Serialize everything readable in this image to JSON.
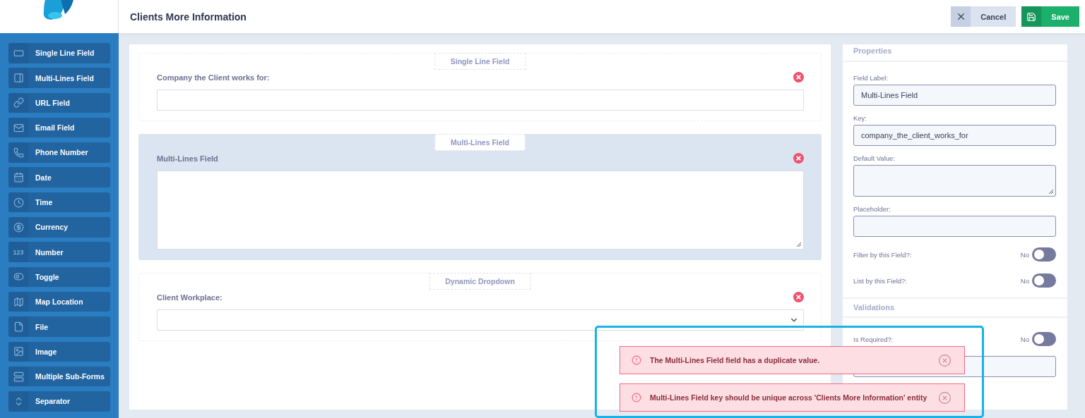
{
  "header": {
    "title": "Clients More Information",
    "buttons": [
      {
        "kind": "cancel",
        "label": "Cancel"
      },
      {
        "kind": "save",
        "label": "Save"
      }
    ]
  },
  "sidebar": {
    "items": [
      {
        "kind": "single",
        "label": "Single Line Field"
      },
      {
        "kind": "multi",
        "label": "Multi-Lines Field"
      },
      {
        "kind": "url",
        "label": "URL Field"
      },
      {
        "kind": "email",
        "label": "Email Field"
      },
      {
        "kind": "phone",
        "label": "Phone Number"
      },
      {
        "kind": "date",
        "label": "Date"
      },
      {
        "kind": "time",
        "label": "Time"
      },
      {
        "kind": "currency",
        "label": "Currency"
      },
      {
        "kind": "number",
        "label": "Number",
        "icon_text": "123"
      },
      {
        "kind": "toggle",
        "label": "Toggle"
      },
      {
        "kind": "map",
        "label": "Map Location"
      },
      {
        "kind": "file",
        "label": "File"
      },
      {
        "kind": "image",
        "label": "Image"
      },
      {
        "kind": "subforms",
        "label": "Multiple Sub-Forms"
      },
      {
        "kind": "separator",
        "label": "Separator"
      }
    ]
  },
  "canvas": {
    "fields": [
      {
        "kind": "single",
        "type_label": "Single Line Field",
        "label": "Company the Client works for:",
        "selected": false
      },
      {
        "kind": "multi",
        "type_label": "Multi-Lines Field",
        "label": "Multi-Lines Field",
        "selected": true
      },
      {
        "kind": "dropdown",
        "type_label": "Dynamic Dropdown",
        "label": "Client Workplace:",
        "selected": false
      }
    ]
  },
  "properties": {
    "title": "Properties",
    "items": [
      {
        "kind": "input",
        "label": "Field Label:",
        "value": "Multi-Lines Field"
      },
      {
        "kind": "input",
        "label": "Key:",
        "value": "company_the_client_works_for"
      },
      {
        "kind": "textarea",
        "label": "Default Value:"
      },
      {
        "kind": "input",
        "label": "Placeholder:"
      },
      {
        "kind": "toggle",
        "label": "Filter by this Field?:",
        "state_text": "No",
        "on": false
      },
      {
        "kind": "toggle",
        "label": "List by this Field?:",
        "state_text": "No",
        "on": false
      }
    ],
    "validations_title": "Validations",
    "validations": [
      {
        "kind": "toggle",
        "label": "Is Required?:",
        "state_text": "No",
        "on": false
      },
      {
        "kind": "input"
      }
    ]
  },
  "notifications": [
    {
      "text": "The Multi-Lines Field field has a duplicate value."
    },
    {
      "text": "Multi-Lines Field key should be unique across 'Clients More Information' entity"
    }
  ]
}
